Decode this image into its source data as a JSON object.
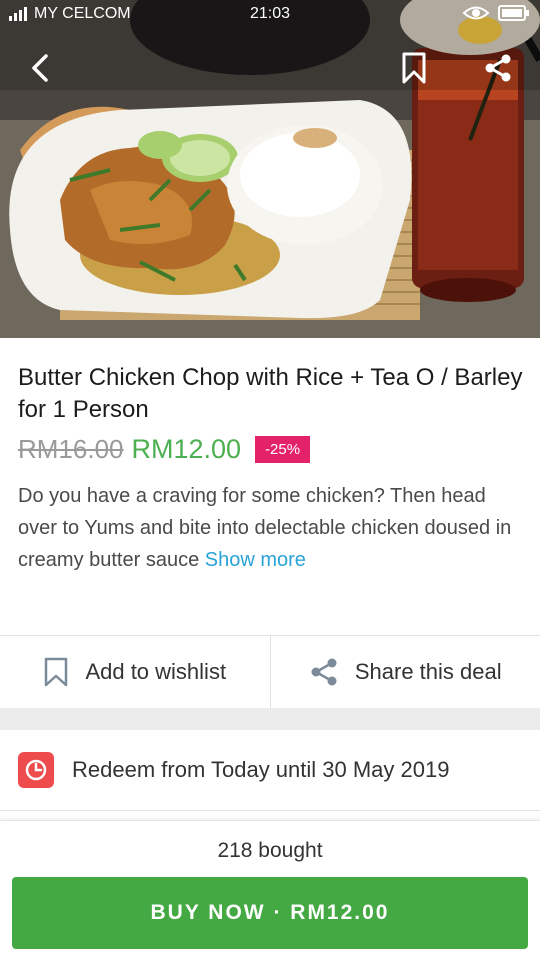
{
  "status_bar": {
    "carrier": "MY CELCOM",
    "time": "21:03"
  },
  "header": {
    "icons": [
      "back-arrow-icon",
      "bookmark-icon",
      "share-icon"
    ]
  },
  "deal": {
    "title": "Butter Chicken Chop with Rice + Tea O / Barley for 1 Person",
    "old_price": "RM16.00",
    "new_price": "RM12.00",
    "discount_badge": "-25%",
    "description": "Do you have a craving for some chicken? Then head over to Yums and bite into delectable chicken doused in creamy butter sauce",
    "show_more": "Show more"
  },
  "actions": {
    "wishlist_label": "Add to wishlist",
    "share_label": "Share this deal"
  },
  "redeem": {
    "text": "Redeem from Today until 30 May 2019"
  },
  "footer": {
    "bought": "218 bought",
    "buy_label": "BUY NOW · RM12.00"
  },
  "colors": {
    "price_green": "#4caf50",
    "discount_pink": "#e4226a",
    "link_blue": "#2aa3d8",
    "buy_button_green": "#45a943",
    "clock_red": "#ee4c4c"
  }
}
